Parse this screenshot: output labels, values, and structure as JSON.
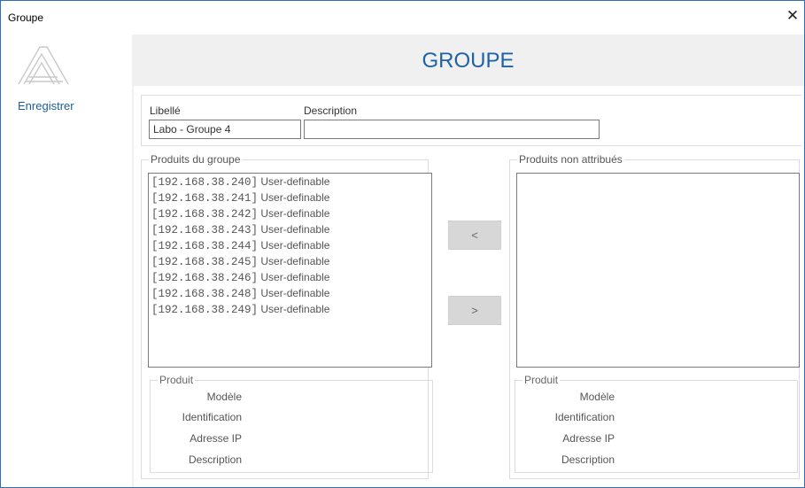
{
  "window": {
    "title": "Groupe",
    "close_glyph": "✕"
  },
  "sidebar": {
    "save_label": "Enregistrer"
  },
  "header": {
    "title": "GROUPE"
  },
  "form": {
    "libelle_label": "Libellé",
    "libelle_value": "Labo - Groupe 4",
    "description_label": "Description",
    "description_value": ""
  },
  "group_products": {
    "legend": "Produits du groupe",
    "items": [
      {
        "ip": "[192.168.38.240]",
        "type": "User-definable"
      },
      {
        "ip": "[192.168.38.241]",
        "type": "User-definable"
      },
      {
        "ip": "[192.168.38.242]",
        "type": "User-definable"
      },
      {
        "ip": "[192.168.38.243]",
        "type": "User-definable"
      },
      {
        "ip": "[192.168.38.244]",
        "type": "User-definable"
      },
      {
        "ip": "[192.168.38.245]",
        "type": "User-definable"
      },
      {
        "ip": "[192.168.38.246]",
        "type": "User-definable"
      },
      {
        "ip": "[192.168.38.248]",
        "type": "User-definable"
      },
      {
        "ip": "[192.168.38.249]",
        "type": "User-definable"
      }
    ]
  },
  "unassigned_products": {
    "legend": "Produits non attribués",
    "items": []
  },
  "transfer": {
    "add_label": "<",
    "remove_label": ">"
  },
  "product_detail_left": {
    "legend": "Produit",
    "fields": {
      "model": "Modèle",
      "identification": "Identification",
      "ip": "Adresse IP",
      "description": "Description"
    }
  },
  "product_detail_right": {
    "legend": "Produit",
    "fields": {
      "model": "Modèle",
      "identification": "Identification",
      "ip": "Adresse IP",
      "description": "Description"
    }
  },
  "icons": {
    "logo": "logo-icon",
    "close": "close-icon"
  }
}
